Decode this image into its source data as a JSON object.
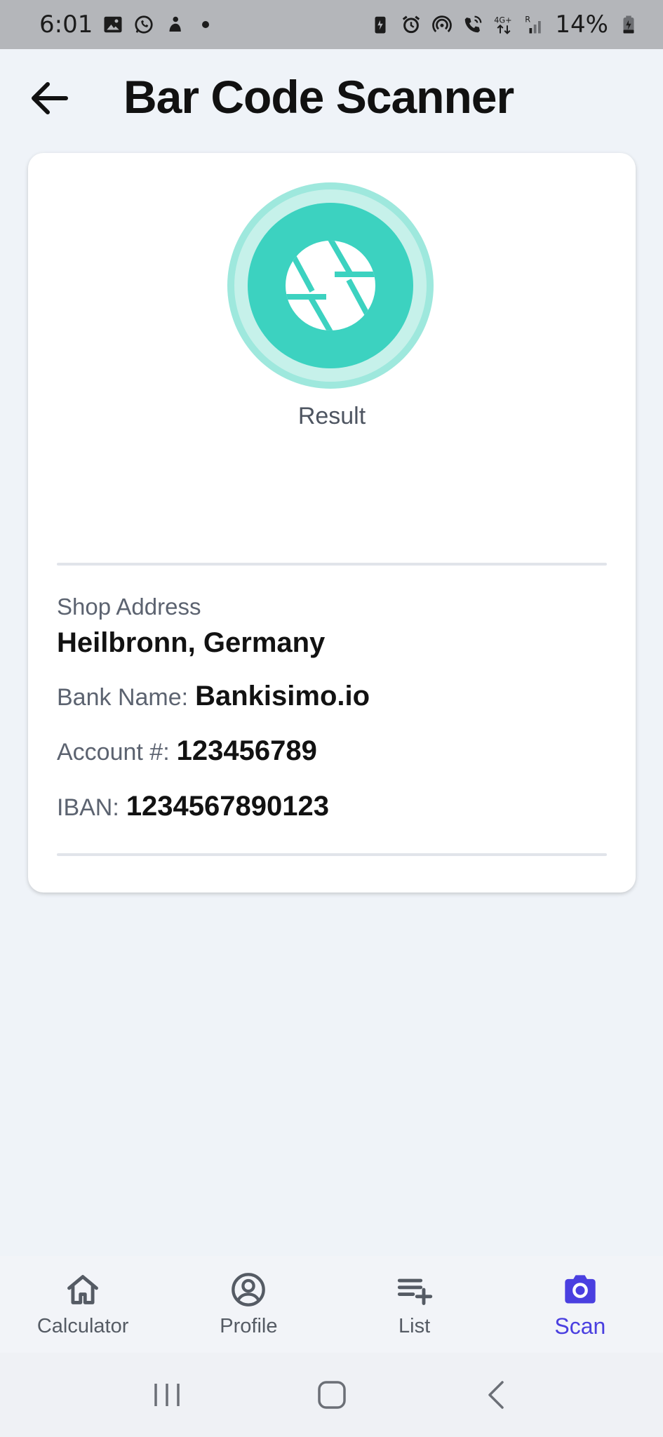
{
  "status_bar": {
    "time": "6:01",
    "battery": "14%",
    "icons_left": [
      "gallery-icon",
      "whatsapp-icon",
      "app-notification-icon",
      "dot-icon"
    ],
    "icons_right": [
      "battery-saver-icon",
      "alarm-icon",
      "hotspot-icon",
      "wifi-call-icon",
      "network-4g-icon",
      "signal-icon",
      "battery-icon"
    ]
  },
  "header": {
    "title": "Bar Code Scanner",
    "back_icon": "arrow-left-icon"
  },
  "result_card": {
    "icon": "camera-aperture-icon",
    "label": "Result",
    "shop_address_label": "Shop Address",
    "shop_address_value": "Heilbronn, Germany",
    "bank_name_label": "Bank Name:",
    "bank_name_value": "Bankisimo.io",
    "account_label": "Account #:",
    "account_value": "123456789",
    "iban_label": "IBAN:",
    "iban_value": "1234567890123"
  },
  "bottom_nav": {
    "items": [
      {
        "label": "Calculator",
        "icon": "home-icon",
        "active": false
      },
      {
        "label": "Profile",
        "icon": "user-circle-icon",
        "active": false
      },
      {
        "label": "List",
        "icon": "playlist-add-icon",
        "active": false
      },
      {
        "label": "Scan",
        "icon": "camera-icon",
        "active": true
      }
    ],
    "active_color": "#4a3fe0"
  },
  "colors": {
    "accent_teal": "#3cd2c0",
    "background": "#eff3f8"
  }
}
